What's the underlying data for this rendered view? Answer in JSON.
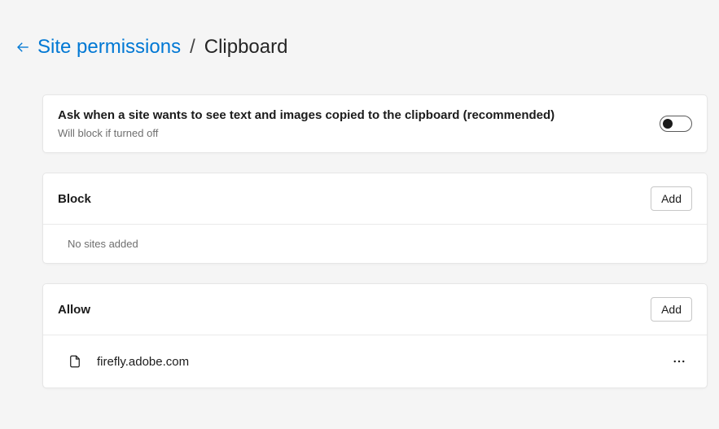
{
  "breadcrumb": {
    "parent": "Site permissions",
    "separator": "/",
    "current": "Clipboard"
  },
  "setting": {
    "title": "Ask when a site wants to see text and images copied to the clipboard (recommended)",
    "subtitle": "Will block if turned off",
    "enabled": false
  },
  "block_section": {
    "title": "Block",
    "add_label": "Add",
    "empty_text": "No sites added",
    "sites": []
  },
  "allow_section": {
    "title": "Allow",
    "add_label": "Add",
    "sites": [
      {
        "name": "firefly.adobe.com"
      }
    ]
  }
}
